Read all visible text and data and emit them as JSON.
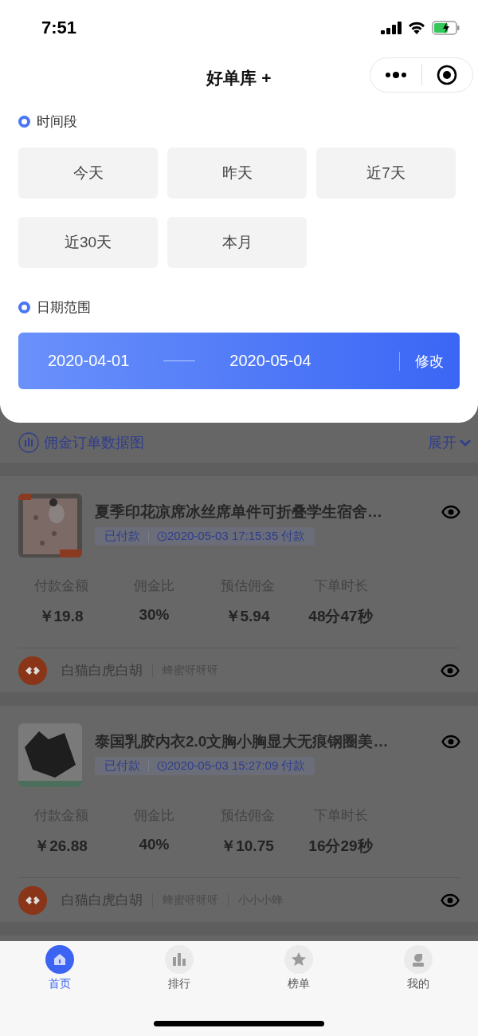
{
  "status_bar": {
    "time": "7:51"
  },
  "nav": {
    "title": "好单库 +"
  },
  "filter_panel": {
    "period_label": "时间段",
    "presets": [
      {
        "label": "今天",
        "selected": false
      },
      {
        "label": "昨天",
        "selected": false
      },
      {
        "label": "近7天",
        "selected": false
      },
      {
        "label": "近30天",
        "selected": false
      },
      {
        "label": "本月",
        "selected": false
      }
    ],
    "range_label": "日期范围",
    "range": {
      "start": "2020-04-01",
      "end": "2020-05-04",
      "edit_button": "修改"
    }
  },
  "chart_toggle": {
    "label": "佣金订单数据图",
    "expand": "展开"
  },
  "orders": [
    {
      "thumbnail": {
        "kind": "picture"
      },
      "title": "夏季印花凉席冰丝席单件可折叠学生宿舍…",
      "status": "已付款",
      "time": "2020-05-03 17:15:35 付款",
      "metrics": [
        {
          "label": "付款金额",
          "value": "￥19.8"
        },
        {
          "label": "佣金比",
          "value": "30%"
        },
        {
          "label": "预估佣金",
          "value": "￥5.94"
        },
        {
          "label": "下单时长",
          "value": "48分47秒"
        }
      ],
      "shop": "白猫白虎白胡",
      "tags": [
        "蜂蜜呀呀呀"
      ]
    },
    {
      "thumbnail": {
        "kind": "picture"
      },
      "title": "泰国乳胶内衣2.0文胸小胸显大无痕钢圈美…",
      "status": "已付款",
      "time": "2020-05-03 15:27:09 付款",
      "metrics": [
        {
          "label": "付款金额",
          "value": "￥26.88"
        },
        {
          "label": "佣金比",
          "value": "40%"
        },
        {
          "label": "预估佣金",
          "value": "￥10.75"
        },
        {
          "label": "下单时长",
          "value": "16分29秒"
        }
      ],
      "shop": "白猫白虎白胡",
      "tags": [
        "蜂蜜呀呀呀",
        "小小小蜂"
      ]
    }
  ],
  "tab_bar": [
    {
      "label": "首页",
      "kind": "home",
      "selected": true
    },
    {
      "label": "排行",
      "kind": "rank",
      "selected": false
    },
    {
      "label": "榜单",
      "kind": "list",
      "selected": false
    },
    {
      "label": "我的",
      "kind": "me",
      "selected": false
    }
  ]
}
